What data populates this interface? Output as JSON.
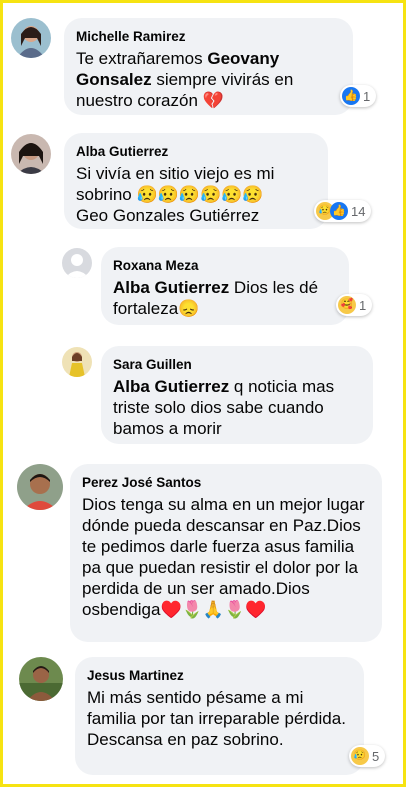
{
  "comments": [
    {
      "name": "Michelle Ramirez",
      "text_pre": "Te extrañaremos ",
      "mention": "Geovany Gonsalez",
      "text_post": " siempre vivirás en nuestro corazón 💔",
      "reactions": [
        "like-icon"
      ],
      "reaction_count": "1"
    },
    {
      "name": "Alba Gutierrez",
      "text_line1": "Si vivía en sitio viejo es mi sobrino 😥😥😥😥😥😥",
      "text_line2": "Geo Gonzales Gutiérrez",
      "reactions": [
        "sad-face-icon",
        "like-icon"
      ],
      "reaction_count": "14"
    },
    {
      "name": "Roxana Meza",
      "mention": "Alba Gutierrez",
      "text_post": " Dios les dé fortaleza😞",
      "reactions": [
        "care-face-icon"
      ],
      "reaction_count": "1"
    },
    {
      "name": "Sara Guillen",
      "mention": "Alba Gutierrez",
      "text_post": " q noticia mas triste solo dios sabe cuando bamos a morir"
    },
    {
      "name": "Perez José Santos",
      "text": "Dios tenga su alma en un mejor lugar dónde pueda descansar en Paz.Dios te pedimos darle fuerza asus familia pa que puedan resistir el dolor por la perdida de un ser amado.Dios osbendiga♥️🌷🙏🌷♥️"
    },
    {
      "name": "Jesus Martinez",
      "text": "Mi más sentido pésame a mi familia por tan irreparable pérdida. Descansa en paz sobrino.",
      "reactions": [
        "sad-face-icon"
      ],
      "reaction_count": "5"
    }
  ],
  "colors": {
    "bubble": "#f0f2f5",
    "frame": "#f6e312",
    "like": "#1877f2"
  }
}
